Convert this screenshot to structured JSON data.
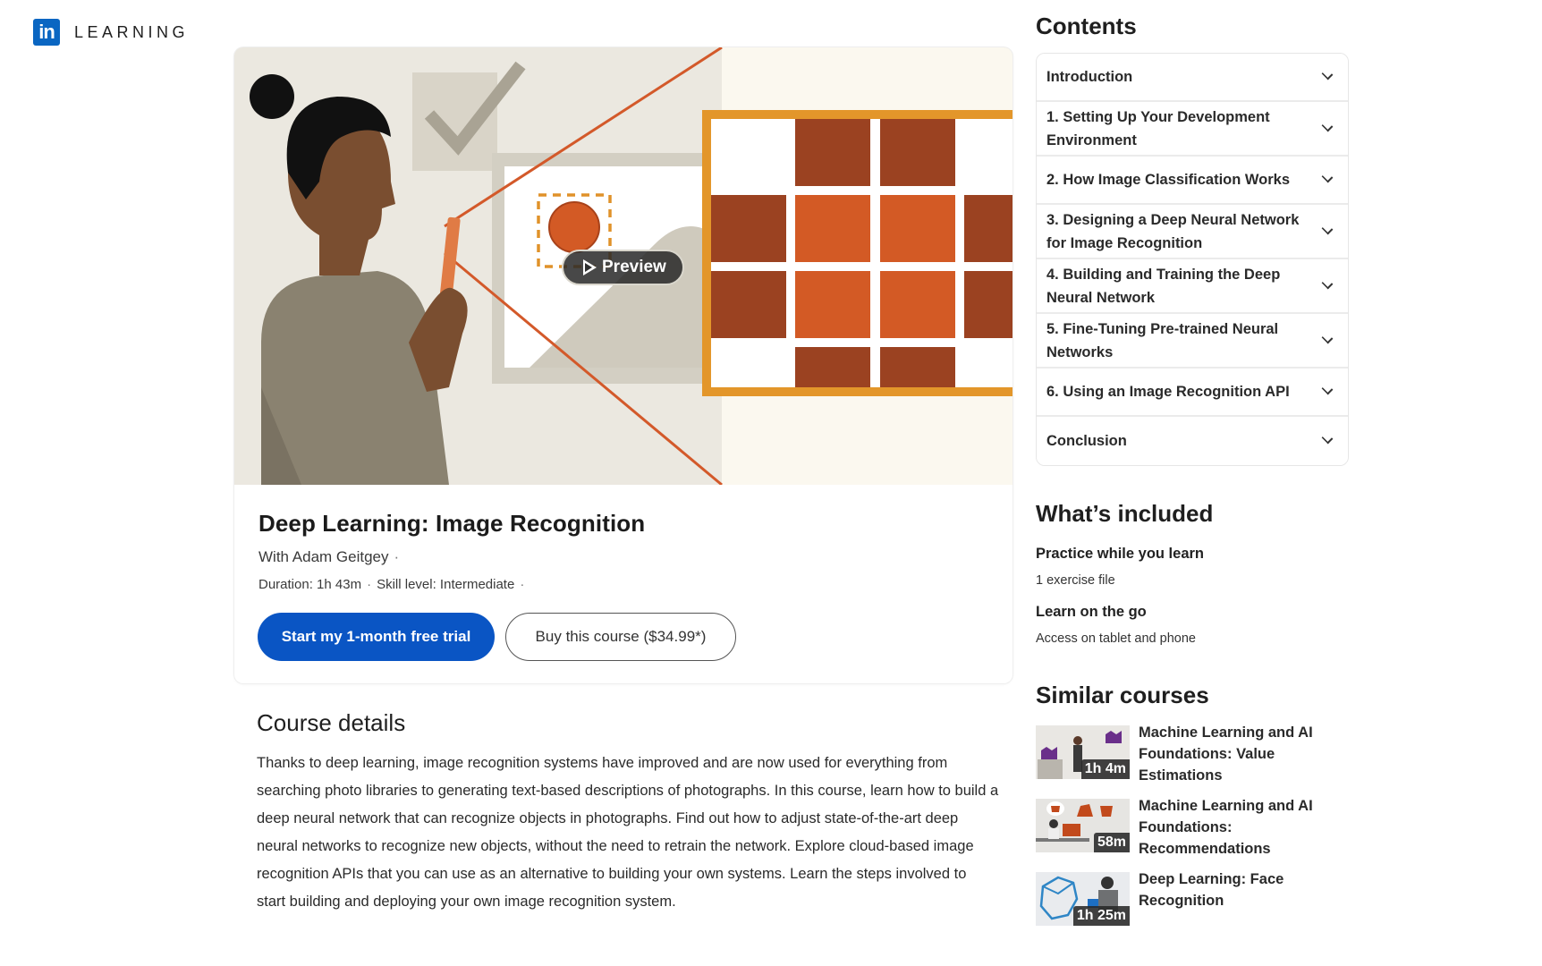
{
  "brand": {
    "logo_mark": "in",
    "logo_text": "LEARNING",
    "accent_color": "#0a66c2"
  },
  "hero": {
    "preview_label": "Preview",
    "illustration": "person-scanning-image-with-phone-pixel-grid"
  },
  "course": {
    "title": "Deep Learning: Image Recognition",
    "author": "With Adam Geitgey",
    "duration": "Duration: 1h 43m",
    "skill_level": "Skill level: Intermediate",
    "separator": "·",
    "primary_cta": "Start my 1-month free trial",
    "secondary_cta": "Buy this course ($34.99*)",
    "primary_color": "#0a55c4"
  },
  "details": {
    "heading": "Course details",
    "body": "Thanks to deep learning, image recognition systems have improved and are now used for everything from searching photo libraries to generating text-based descriptions of photographs. In this course, learn how to build a deep neural network that can recognize objects in photographs. Find out how to adjust state-of-the-art deep neural networks to recognize new objects, without the need to retrain the network. Explore cloud-based image recognition APIs that you can use as an alternative to building your own systems. Learn the steps involved to start building and deploying your own image recognition system."
  },
  "contents": {
    "heading": "Contents",
    "items": [
      {
        "label": "Introduction"
      },
      {
        "label": "1. Setting Up Your Development Environment"
      },
      {
        "label": "2. How Image Classification Works"
      },
      {
        "label": "3. Designing a Deep Neural Network for Image Recognition"
      },
      {
        "label": "4. Building and Training the Deep Neural Network"
      },
      {
        "label": "5. Fine-Tuning Pre-trained Neural Networks"
      },
      {
        "label": "6. Using an Image Recognition API"
      },
      {
        "label": "Conclusion"
      }
    ]
  },
  "included": {
    "heading": "What’s included",
    "items": [
      {
        "title": "Practice while you learn",
        "subtitle": "1 exercise file"
      },
      {
        "title": "Learn on the go",
        "subtitle": "Access on tablet and phone"
      }
    ]
  },
  "similar": {
    "heading": "Similar courses",
    "items": [
      {
        "title": "Machine Learning and AI Foundations: Value Estimations",
        "duration": "1h 4m"
      },
      {
        "title": "Machine Learning and AI Foundations: Recommendations",
        "duration": "58m"
      },
      {
        "title": "Deep Learning: Face Recognition",
        "duration": "1h 25m"
      }
    ]
  }
}
